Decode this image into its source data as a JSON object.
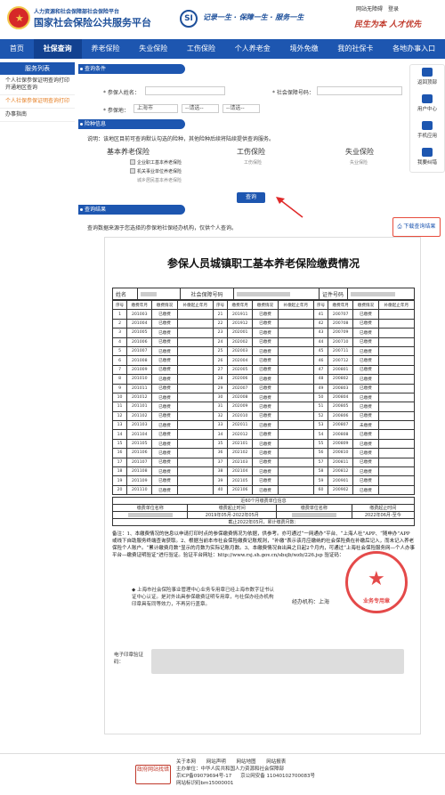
{
  "header": {
    "ministry": "人力资源和社会保障部社会保险平台",
    "platform": "国家社会保险公共服务平台",
    "si_logo": "SI",
    "slogan": "记录一生 · 保障一生 · 服务一生",
    "links": [
      "网站无障碍",
      "登录"
    ],
    "calligraphy": "民生为本 人才优先"
  },
  "nav": [
    "首页",
    "社保查询",
    "养老保险",
    "失业保险",
    "工伤保险",
    "个人养老金",
    "境外免缴",
    "我的社保卡",
    "各地办事入口"
  ],
  "sidebar": {
    "title": "服务列表",
    "items": [
      "个人社保参保证明查询打印开通地区查询",
      "个人社保参保证明查询打印",
      "办事指南"
    ]
  },
  "query": {
    "section": "查询条件",
    "name_label": "* 参保人姓名：",
    "id_label": "* 社会保障号码：",
    "place_label": "* 参保地：",
    "place_value": "上海市",
    "select2": "--请选--",
    "select3": "--请选--",
    "section2": "险种信息",
    "note": "说明：该地区目前可查询默认勾选的险种，其他险种后续将陆续提供查询服务。",
    "pension_title": "基本养老保险",
    "pension_items": [
      "企业职工基本养老保险",
      "机关事业单位养老保险",
      "城乡居民基本养老保险"
    ],
    "injury_title": "工伤保险",
    "injury_item": "工伤保险",
    "unemp_title": "失业保险",
    "unemp_item": "失业保险",
    "query_button": "查询",
    "section3": "查询结果",
    "result_note": "查询数据来源于您选择的参保地社保经办机构，仅供个人查询。",
    "download": "下载查询结果"
  },
  "tools": [
    "返回顶部",
    "用户中心",
    "手机应用",
    "我要纠错"
  ],
  "cert": {
    "title": "参保人员城镇职工基本养老保险缴费情况",
    "name_label": "姓名",
    "ssn_label": "社会保障号码",
    "doc_label": "证件号码",
    "headers": [
      "序号",
      "缴费年月",
      "缴费情况",
      "补缴起止年月"
    ],
    "rows": [
      [
        "1",
        "201003",
        "已缴费",
        "21",
        "201911",
        "已缴费",
        "41",
        "200707",
        "已缴费"
      ],
      [
        "2",
        "201004",
        "已缴费",
        "22",
        "201912",
        "已缴费",
        "42",
        "200708",
        "已缴费"
      ],
      [
        "3",
        "201005",
        "已缴费",
        "23",
        "202001",
        "已缴费",
        "43",
        "200709",
        "已缴费"
      ],
      [
        "4",
        "201006",
        "已缴费",
        "24",
        "202002",
        "已缴费",
        "44",
        "200710",
        "已缴费"
      ],
      [
        "5",
        "201007",
        "已缴费",
        "25",
        "202003",
        "已缴费",
        "45",
        "200711",
        "已缴费"
      ],
      [
        "6",
        "201008",
        "已缴费",
        "26",
        "202004",
        "已缴费",
        "46",
        "200712",
        "已缴费"
      ],
      [
        "7",
        "201009",
        "已缴费",
        "27",
        "202005",
        "已缴费",
        "47",
        "200801",
        "已缴费"
      ],
      [
        "8",
        "201010",
        "已缴费",
        "28",
        "202006",
        "已缴费",
        "48",
        "200802",
        "已缴费"
      ],
      [
        "9",
        "201011",
        "已缴费",
        "29",
        "202007",
        "已缴费",
        "49",
        "200803",
        "已缴费"
      ],
      [
        "10",
        "201012",
        "已缴费",
        "30",
        "202008",
        "已缴费",
        "50",
        "200804",
        "已缴费"
      ],
      [
        "11",
        "201101",
        "已缴费",
        "31",
        "202009",
        "已缴费",
        "51",
        "200805",
        "已缴费"
      ],
      [
        "12",
        "201102",
        "已缴费",
        "32",
        "202010",
        "已缴费",
        "52",
        "200806",
        "已缴费"
      ],
      [
        "13",
        "201103",
        "已缴费",
        "33",
        "202011",
        "已缴费",
        "53",
        "200807",
        "未缴费"
      ],
      [
        "14",
        "201104",
        "已缴费",
        "34",
        "202012",
        "已缴费",
        "54",
        "200808",
        "已缴费"
      ],
      [
        "15",
        "201105",
        "已缴费",
        "35",
        "202101",
        "已缴费",
        "55",
        "200809",
        "已缴费"
      ],
      [
        "16",
        "201106",
        "已缴费",
        "36",
        "202102",
        "已缴费",
        "56",
        "200810",
        "已缴费"
      ],
      [
        "17",
        "201107",
        "已缴费",
        "37",
        "202103",
        "已缴费",
        "57",
        "200811",
        "已缴费"
      ],
      [
        "18",
        "201108",
        "已缴费",
        "38",
        "202104",
        "已缴费",
        "58",
        "200812",
        "已缴费"
      ],
      [
        "19",
        "201109",
        "已缴费",
        "39",
        "202105",
        "已缴费",
        "59",
        "200901",
        "已缴费"
      ],
      [
        "20",
        "201110",
        "已缴费",
        "40",
        "202106",
        "已缴费",
        "60",
        "200902",
        "已缴费"
      ]
    ],
    "summary_title": "近60个月缴费单位信息",
    "bottom_headers": [
      "缴费单位名称",
      "缴费起止时间",
      "缴费单位名称",
      "缴费起止时间"
    ],
    "period1": "2019年05月-2022年05月",
    "period2": "2022年06月-至今",
    "total": "截止2022年05月，累计缴费月数：",
    "notes": "备注：1、本缴费情况的信息以申请打印时点的参保缴费情况为依据，供参考。亦可通过“一网通办”平台、“上海人社”APP、“随申办”APP或线下自助服务终端查询获取。2、根据当前本市社会保险缴费记账规则，“补缴”表示该月应缴纳的社会保险费在补缴后记入，而未记入养老保险个人账户。“累计缴费月数”显示的月数为实际记账月数。3、本缴费情况自出具之日起2个月内，可通过“上海社会保险服务网—个人办事平台—缴费证明验证”进行验证。验证平台网址：http://www.rsj.sh.gov.cn/sbsjb/wzb/226.jsp  验证码：",
    "issuer": "◆ 上海市社会保险事业管理中心业务专用章已经上海市数字证书认证中心认证。是对外出具参保缴费证明专用章，与社保办经办机构印章具有同等效力，不再另行盖章。",
    "agency": "经办机构：上海",
    "seal": "业务专用章",
    "esign": "电子印章验证码："
  },
  "footer": {
    "badge": "政府网站找错",
    "links": [
      "关于本网",
      "网站声明",
      "网站地图",
      "网站报表"
    ],
    "sponsor": "主办单位：中华人民共和国人力资源和社会保障部",
    "icp": "京ICP备09079694号-17",
    "police": "京公网安备 11040102700083号",
    "code": "网站标识码bm15000001"
  }
}
